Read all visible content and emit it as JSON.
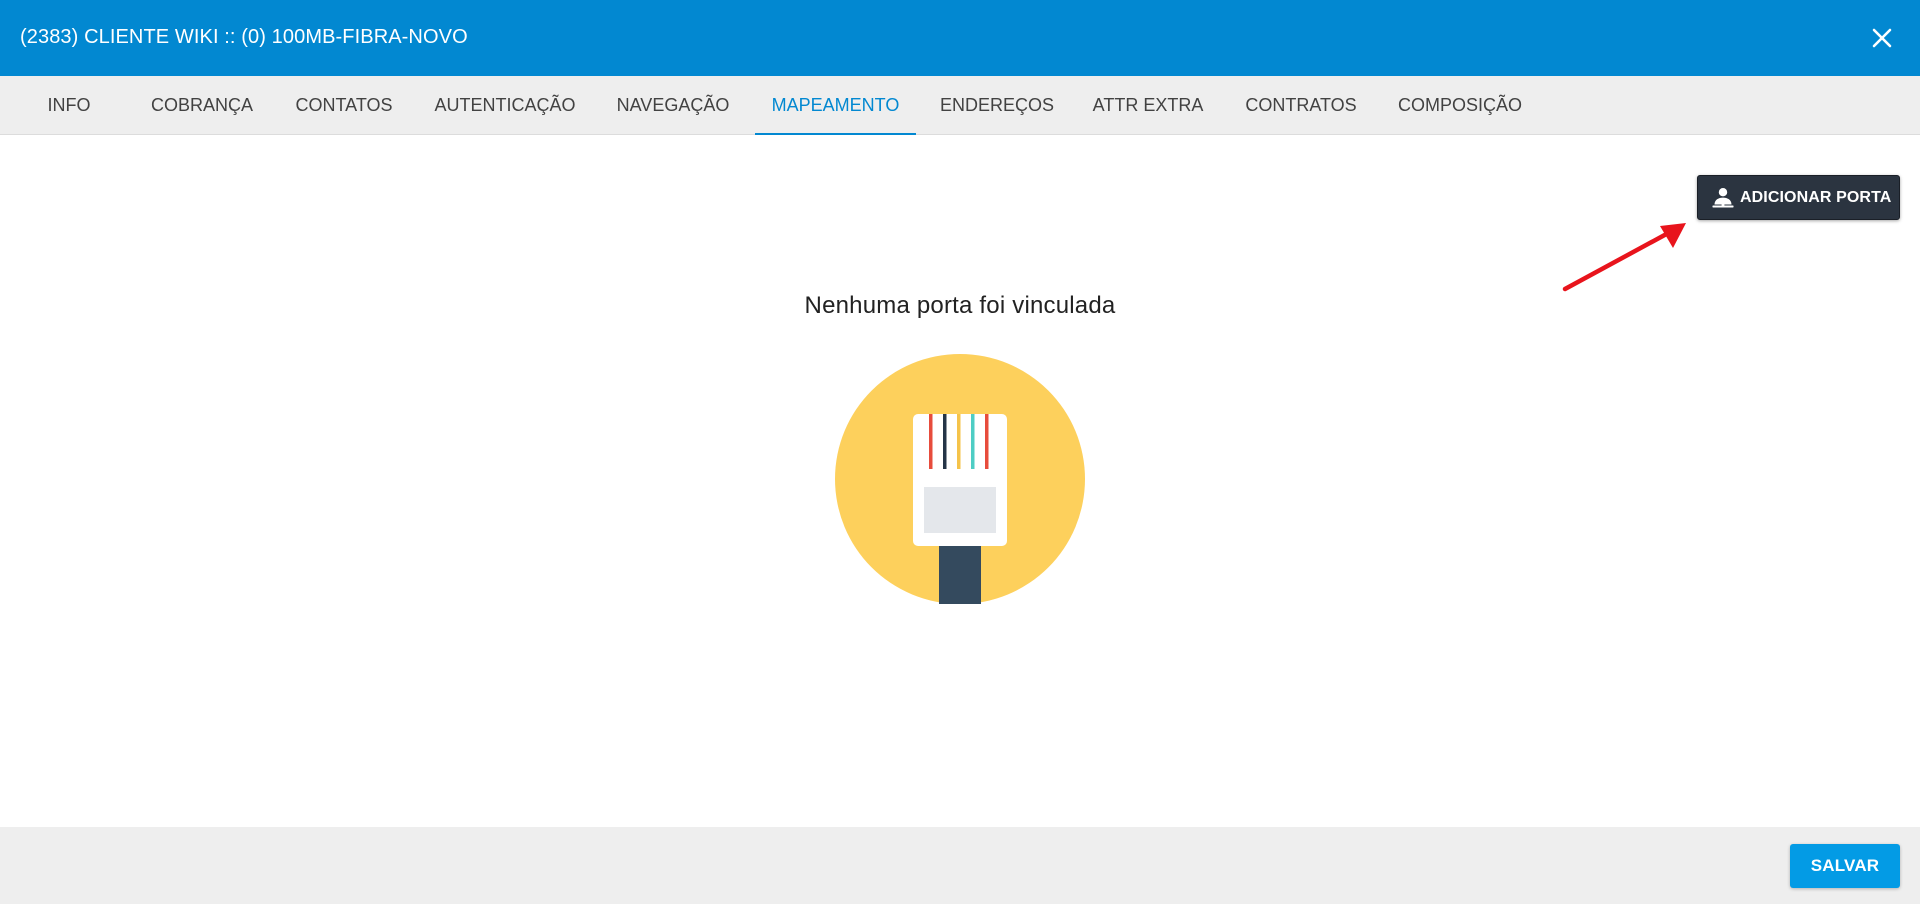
{
  "header": {
    "title": "(2383) CLIENTE WIKI :: (0) 100MB-FIBRA-NOVO",
    "close_icon": "close-icon"
  },
  "tabs": [
    {
      "label": "INFO",
      "active": false
    },
    {
      "label": "COBRANÇA",
      "active": false
    },
    {
      "label": "CONTATOS",
      "active": false
    },
    {
      "label": "AUTENTICAÇÃO",
      "active": false
    },
    {
      "label": "NAVEGAÇÃO",
      "active": false
    },
    {
      "label": "MAPEAMENTO",
      "active": true
    },
    {
      "label": "ENDEREÇOS",
      "active": false
    },
    {
      "label": "ATTR EXTRA",
      "active": false
    },
    {
      "label": "CONTRATOS",
      "active": false
    },
    {
      "label": "COMPOSIÇÃO",
      "active": false
    }
  ],
  "main": {
    "add_port_button": {
      "label": "ADICIONAR PORTA",
      "icon": "user-port-icon"
    },
    "empty_state": {
      "message": "Nenhuma porta foi vinculada",
      "illustration": "ethernet-connector-icon"
    },
    "annotation": "red-arrow-pointing-to-add-port-button"
  },
  "footer": {
    "save_label": "SALVAR"
  },
  "colors": {
    "header_bg": "#0288d1",
    "tab_active": "#0288d1",
    "button_dark": "#2b3440",
    "save_button": "#039be5",
    "illustration_circle": "#fdd05c",
    "annotation_arrow": "#e8141c"
  }
}
